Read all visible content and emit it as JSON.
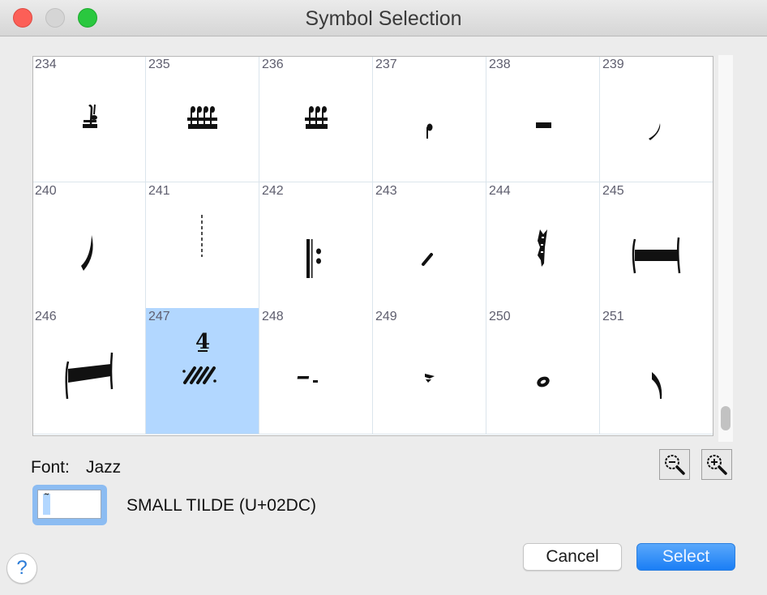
{
  "window": {
    "title": "Symbol Selection",
    "controls": [
      "close",
      "minimize",
      "maximize"
    ]
  },
  "grid": {
    "columns": 6,
    "selected_index": 247,
    "cells": [
      {
        "index": 234,
        "glyph": "grace-note-beamed-single-icon"
      },
      {
        "index": 235,
        "glyph": "four-grace-notes-beamed-icon"
      },
      {
        "index": 236,
        "glyph": "three-grace-notes-beamed-icon"
      },
      {
        "index": 237,
        "glyph": "small-note-head-stem-icon"
      },
      {
        "index": 238,
        "glyph": "whole-rest-bar-icon"
      },
      {
        "index": 239,
        "glyph": "fall-curve-short-icon"
      },
      {
        "index": 240,
        "glyph": "fall-curve-long-icon"
      },
      {
        "index": 241,
        "glyph": "dashed-barline-icon"
      },
      {
        "index": 242,
        "glyph": "repeat-start-icon"
      },
      {
        "index": 243,
        "glyph": "slash-short-icon"
      },
      {
        "index": 244,
        "glyph": "arpeggio-wavy-icon"
      },
      {
        "index": 245,
        "glyph": "multi-rest-bar-icon"
      },
      {
        "index": 246,
        "glyph": "multi-rest-slanted-icon"
      },
      {
        "index": 247,
        "glyph": "four-slash-repeat-icon"
      },
      {
        "index": 248,
        "glyph": "half-rest-small-icon"
      },
      {
        "index": 249,
        "glyph": "quarter-rest-small-icon"
      },
      {
        "index": 250,
        "glyph": "note-head-oval-icon"
      },
      {
        "index": 251,
        "glyph": "breath-curve-icon"
      }
    ]
  },
  "font": {
    "label": "Font:",
    "value": "Jazz"
  },
  "character": {
    "field_value": "˜",
    "description": "SMALL TILDE (U+02DC)"
  },
  "zoom": {
    "out_icon": "zoom-out-icon",
    "in_icon": "zoom-in-icon"
  },
  "buttons": {
    "help": "?",
    "cancel": "Cancel",
    "select": "Select"
  },
  "colors": {
    "selection": "#b2d7ff",
    "primary_button": "#1a7ef5",
    "help_icon": "#2a7bd8"
  }
}
